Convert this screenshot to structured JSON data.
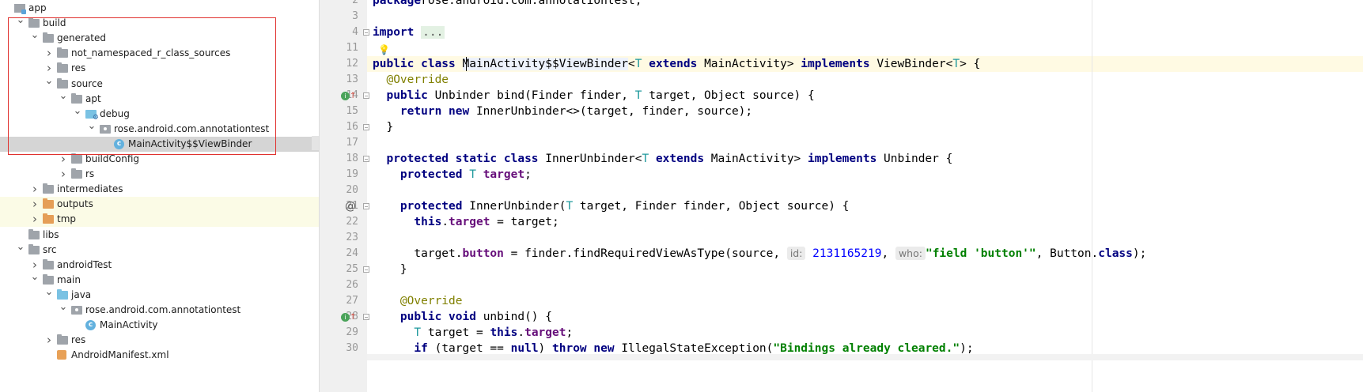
{
  "tree": {
    "rows": [
      {
        "label": "app",
        "depth": 0,
        "arrow": "",
        "icon": "module"
      },
      {
        "label": "build",
        "depth": 1,
        "arrow": "down",
        "icon": "folder"
      },
      {
        "label": "generated",
        "depth": 2,
        "arrow": "down",
        "icon": "folder"
      },
      {
        "label": "not_namespaced_r_class_sources",
        "depth": 3,
        "arrow": "right",
        "icon": "folder"
      },
      {
        "label": "res",
        "depth": 3,
        "arrow": "right",
        "icon": "folder"
      },
      {
        "label": "source",
        "depth": 3,
        "arrow": "down",
        "icon": "folder"
      },
      {
        "label": "apt",
        "depth": 4,
        "arrow": "down",
        "icon": "folder"
      },
      {
        "label": "debug",
        "depth": 5,
        "arrow": "down",
        "icon": "debug-folder"
      },
      {
        "label": "rose.android.com.annotationtest",
        "depth": 6,
        "arrow": "down",
        "icon": "package"
      },
      {
        "label": "MainActivity$$ViewBinder",
        "depth": 7,
        "arrow": "",
        "icon": "class",
        "selected": true
      },
      {
        "label": "buildConfig",
        "depth": 4,
        "arrow": "right",
        "icon": "folder"
      },
      {
        "label": "rs",
        "depth": 4,
        "arrow": "right",
        "icon": "folder"
      },
      {
        "label": "intermediates",
        "depth": 2,
        "arrow": "right",
        "icon": "folder"
      },
      {
        "label": "outputs",
        "depth": 2,
        "arrow": "right",
        "icon": "folder-orange",
        "highlight": true
      },
      {
        "label": "tmp",
        "depth": 2,
        "arrow": "right",
        "icon": "folder-orange",
        "highlight": true
      },
      {
        "label": "libs",
        "depth": 1,
        "arrow": "",
        "icon": "folder"
      },
      {
        "label": "src",
        "depth": 1,
        "arrow": "down",
        "icon": "folder"
      },
      {
        "label": "androidTest",
        "depth": 2,
        "arrow": "right",
        "icon": "folder"
      },
      {
        "label": "main",
        "depth": 2,
        "arrow": "down",
        "icon": "folder"
      },
      {
        "label": "java",
        "depth": 3,
        "arrow": "down",
        "icon": "folder-blue"
      },
      {
        "label": "rose.android.com.annotationtest",
        "depth": 4,
        "arrow": "down",
        "icon": "package"
      },
      {
        "label": "MainActivity",
        "depth": 5,
        "arrow": "",
        "icon": "class"
      },
      {
        "label": "res",
        "depth": 3,
        "arrow": "right",
        "icon": "folder"
      },
      {
        "label": "AndroidManifest.xml",
        "depth": 3,
        "arrow": "",
        "icon": "xml"
      }
    ]
  },
  "editor": {
    "lines": [
      {
        "num": "2",
        "tokens": [
          [
            "kw",
            "package"
          ],
          [
            "",
            "rose.android.com.annotationtest;"
          ]
        ]
      },
      {
        "num": "3",
        "tokens": []
      },
      {
        "num": "4",
        "tokens": [
          [
            "kw",
            "import "
          ],
          [
            "fold-text",
            "..."
          ]
        ],
        "fold": "start"
      },
      {
        "num": "11",
        "tokens": []
      },
      {
        "num": "12",
        "tokens": [
          [
            "kw",
            "public class "
          ],
          [
            "sym",
            "MainActivity$$ViewBinder"
          ],
          [
            "",
            "<"
          ],
          [
            "tp",
            "T"
          ],
          [
            "kw",
            " extends "
          ],
          [
            "",
            "MainActivity> "
          ],
          [
            "kw",
            "implements "
          ],
          [
            "",
            "ViewBinder<"
          ],
          [
            "tp",
            "T"
          ],
          [
            "",
            "> {"
          ]
        ]
      },
      {
        "num": "13",
        "tokens": [
          [
            "",
            "  "
          ],
          [
            "ann",
            "@Override"
          ]
        ]
      },
      {
        "num": "14",
        "tokens": [
          [
            "",
            "  "
          ],
          [
            "kw",
            "public "
          ],
          [
            "",
            "Unbinder bind(Finder finder, "
          ],
          [
            "tp",
            "T"
          ],
          [
            "",
            " target, Object source) {"
          ]
        ],
        "fold": "start",
        "gutter": "impl-icon"
      },
      {
        "num": "15",
        "tokens": [
          [
            "",
            "    "
          ],
          [
            "kw",
            "return new "
          ],
          [
            "",
            "InnerUnbinder<>(target, finder, source);"
          ]
        ]
      },
      {
        "num": "16",
        "tokens": [
          [
            "",
            "  }"
          ]
        ],
        "fold": "end"
      },
      {
        "num": "17",
        "tokens": []
      },
      {
        "num": "18",
        "tokens": [
          [
            "",
            "  "
          ],
          [
            "kw",
            "protected static class "
          ],
          [
            "",
            "InnerUnbinder<"
          ],
          [
            "tp",
            "T"
          ],
          [
            "kw",
            " extends "
          ],
          [
            "",
            "MainActivity> "
          ],
          [
            "kw",
            "implements "
          ],
          [
            "",
            "Unbinder {"
          ]
        ],
        "fold": "start"
      },
      {
        "num": "19",
        "tokens": [
          [
            "",
            "    "
          ],
          [
            "kw",
            "protected "
          ],
          [
            "tp",
            "T "
          ],
          [
            "fld",
            "target"
          ],
          [
            "",
            ";"
          ]
        ]
      },
      {
        "num": "20",
        "tokens": []
      },
      {
        "num": "21",
        "tokens": [
          [
            "",
            "    "
          ],
          [
            "kw",
            "protected "
          ],
          [
            "",
            "InnerUnbinder("
          ],
          [
            "tp",
            "T"
          ],
          [
            "",
            " target, Finder finder, Object source) {"
          ]
        ],
        "fold": "start",
        "gutter": "at-icon"
      },
      {
        "num": "22",
        "tokens": [
          [
            "",
            "      "
          ],
          [
            "kw",
            "this"
          ],
          [
            "",
            "."
          ],
          [
            "fld",
            "target"
          ],
          [
            "",
            " = target;"
          ]
        ]
      },
      {
        "num": "23",
        "tokens": []
      },
      {
        "num": "24",
        "tokens": [
          [
            "",
            "      target."
          ],
          [
            "fld",
            "button"
          ],
          [
            "",
            " = finder.findRequiredViewAsType(source, "
          ],
          [
            "hint",
            "id:"
          ],
          [
            "",
            " "
          ],
          [
            "num",
            "2131165219"
          ],
          [
            "",
            ", "
          ],
          [
            "hint",
            "who:"
          ],
          [
            "str",
            "\"field 'button'\""
          ],
          [
            "",
            ", Button."
          ],
          [
            "kw",
            "class"
          ],
          [
            "",
            ");"
          ]
        ]
      },
      {
        "num": "25",
        "tokens": [
          [
            "",
            "    }"
          ]
        ],
        "fold": "end"
      },
      {
        "num": "26",
        "tokens": []
      },
      {
        "num": "27",
        "tokens": [
          [
            "",
            "    "
          ],
          [
            "ann",
            "@Override"
          ]
        ]
      },
      {
        "num": "28",
        "tokens": [
          [
            "",
            "    "
          ],
          [
            "kw",
            "public void "
          ],
          [
            "",
            "unbind() {"
          ]
        ],
        "fold": "start",
        "gutter": "impl-icon"
      },
      {
        "num": "29",
        "tokens": [
          [
            "",
            "      "
          ],
          [
            "tp",
            "T"
          ],
          [
            "",
            " target = "
          ],
          [
            "kw",
            "this"
          ],
          [
            "",
            "."
          ],
          [
            "fld",
            "target"
          ],
          [
            "",
            ";"
          ]
        ]
      },
      {
        "num": "30",
        "tokens": [
          [
            "",
            "      "
          ],
          [
            "kw",
            "if "
          ],
          [
            "",
            "(target == "
          ],
          [
            "kw",
            "null"
          ],
          [
            "",
            ") "
          ],
          [
            "kw",
            "throw new "
          ],
          [
            "",
            "IllegalStateException("
          ],
          [
            "str",
            "\"Bindings already cleared.\""
          ],
          [
            "",
            ");"
          ]
        ]
      }
    ]
  },
  "colors": {
    "selection": "#d5d5d5",
    "highlight_box": "#e0322f",
    "current_line": "#fffae3",
    "keyword": "#000080",
    "annotation": "#808000",
    "string": "#008000",
    "field": "#660e7a",
    "type_param": "#20999d",
    "number": "#0000ff"
  }
}
